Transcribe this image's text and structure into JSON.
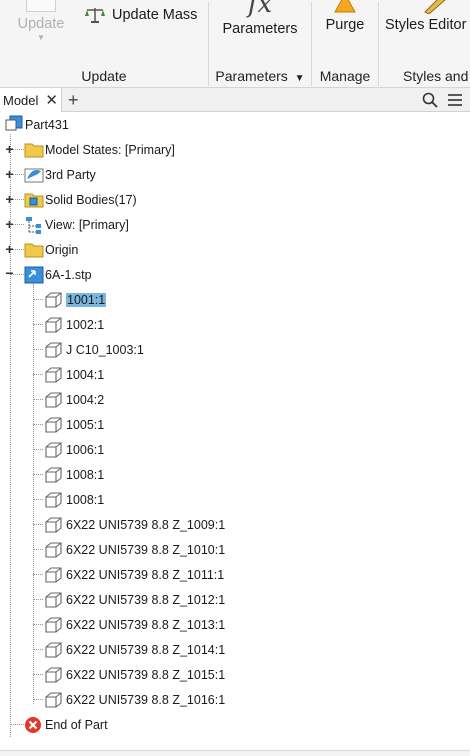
{
  "ribbon": {
    "update_button": "Update",
    "update_mass_button": "Update Mass",
    "update_panel_title": "Update",
    "parameters_button": "Parameters",
    "parameters_panel_title": "Parameters",
    "purge_button": "Purge",
    "manage_panel_title": "Manage",
    "styles_editor_button": "Styles Editor",
    "styles_panel_title": "Styles and"
  },
  "browser": {
    "tab_label": "Model",
    "close_glyph": "✕",
    "add_glyph": "+"
  },
  "tree": {
    "root": "Part431",
    "top_items": [
      {
        "label": "Model States: [Primary]",
        "icon": "folder-icon"
      },
      {
        "label": "3rd Party",
        "icon": "third-party-icon"
      },
      {
        "label": "Solid Bodies(17)",
        "icon": "solid-bodies-folder-icon"
      },
      {
        "label": "View: [Primary]",
        "icon": "view-icon"
      },
      {
        "label": "Origin",
        "icon": "folder-icon"
      }
    ],
    "import": {
      "label": "6A-1.stp",
      "icon": "imported-component-icon"
    },
    "children": [
      "1001:1",
      "1002:1",
      "J C10_1003:1",
      "1004:1",
      "1004:2",
      "1005:1",
      "1006:1",
      "1008:1",
      "1008:1",
      "6X22 UNI5739 8.8 Z_1009:1",
      "6X22 UNI5739 8.8 Z_1010:1",
      "6X22 UNI5739 8.8 Z_1011:1",
      "6X22 UNI5739 8.8 Z_1012:1",
      "6X22 UNI5739 8.8 Z_1013:1",
      "6X22 UNI5739 8.8 Z_1014:1",
      "6X22 UNI5739 8.8 Z_1015:1",
      "6X22 UNI5739 8.8 Z_1016:1"
    ],
    "selected_child": "1001:1",
    "end": "End of Part"
  },
  "colors": {
    "selection": "#7ab7e0",
    "folder": "#f2c84b",
    "end_of_part": "#e0392b",
    "purge_cone": "#f5a623",
    "part_blue": "#3a8fd8"
  }
}
